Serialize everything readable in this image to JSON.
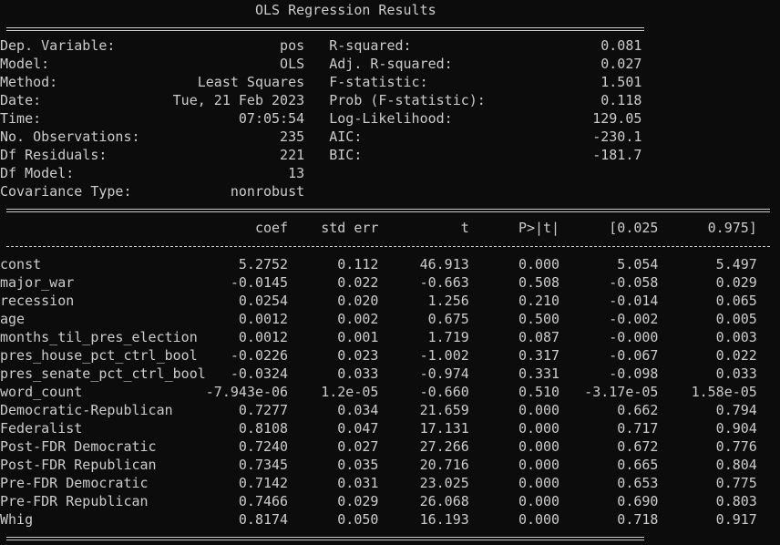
{
  "title": "                               OLS Regression Results",
  "header_rows": [
    "Dep. Variable:                    pos   R-squared:                       0.081",
    "Model:                            OLS   Adj. R-squared:                  0.027",
    "Method:                 Least Squares   F-statistic:                     1.501",
    "Date:                Tue, 21 Feb 2023   Prob (F-statistic):              0.118",
    "Time:                        07:05:54   Log-Likelihood:                 129.05",
    "No. Observations:                 235   AIC:                            -230.1",
    "Df Residuals:                     221   BIC:                            -181.7",
    "Df Model:                          13",
    "Covariance Type:            nonrobust"
  ],
  "table_header": "                               coef    std err          t      P>|t|      [0.025      0.975]",
  "table_rows": [
    "const                        5.2752      0.112     46.913      0.000       5.054       5.497",
    "major_war                   -0.0145      0.022     -0.663      0.508      -0.058       0.029",
    "recession                    0.0254      0.020      1.256      0.210      -0.014       0.065",
    "age                          0.0012      0.002      0.675      0.500      -0.002       0.005",
    "months_til_pres_election     0.0012      0.001      1.719      0.087      -0.000       0.003",
    "pres_house_pct_ctrl_bool    -0.0226      0.023     -1.002      0.317      -0.067       0.022",
    "pres_senate_pct_ctrl_bool   -0.0324      0.033     -0.974      0.331      -0.098       0.033",
    "word_count               -7.943e-06    1.2e-05     -0.660      0.510   -3.17e-05    1.58e-05",
    "Democratic-Republican        0.7277      0.034     21.659      0.000       0.662       0.794",
    "Federalist                   0.8108      0.047     17.131      0.000       0.717       0.904",
    "Post-FDR Democratic          0.7240      0.027     27.266      0.000       0.672       0.776",
    "Post-FDR Republican          0.7345      0.035     20.716      0.000       0.665       0.804",
    "Pre-FDR Democratic           0.7142      0.031     23.025      0.000       0.653       0.775",
    "Pre-FDR Republican           0.7466      0.029     26.068      0.000       0.690       0.803",
    "Whig                         0.8174      0.050     16.193      0.000       0.718       0.917"
  ],
  "colors": {
    "background": "#0c0c0c",
    "text": "#cccccc"
  }
}
